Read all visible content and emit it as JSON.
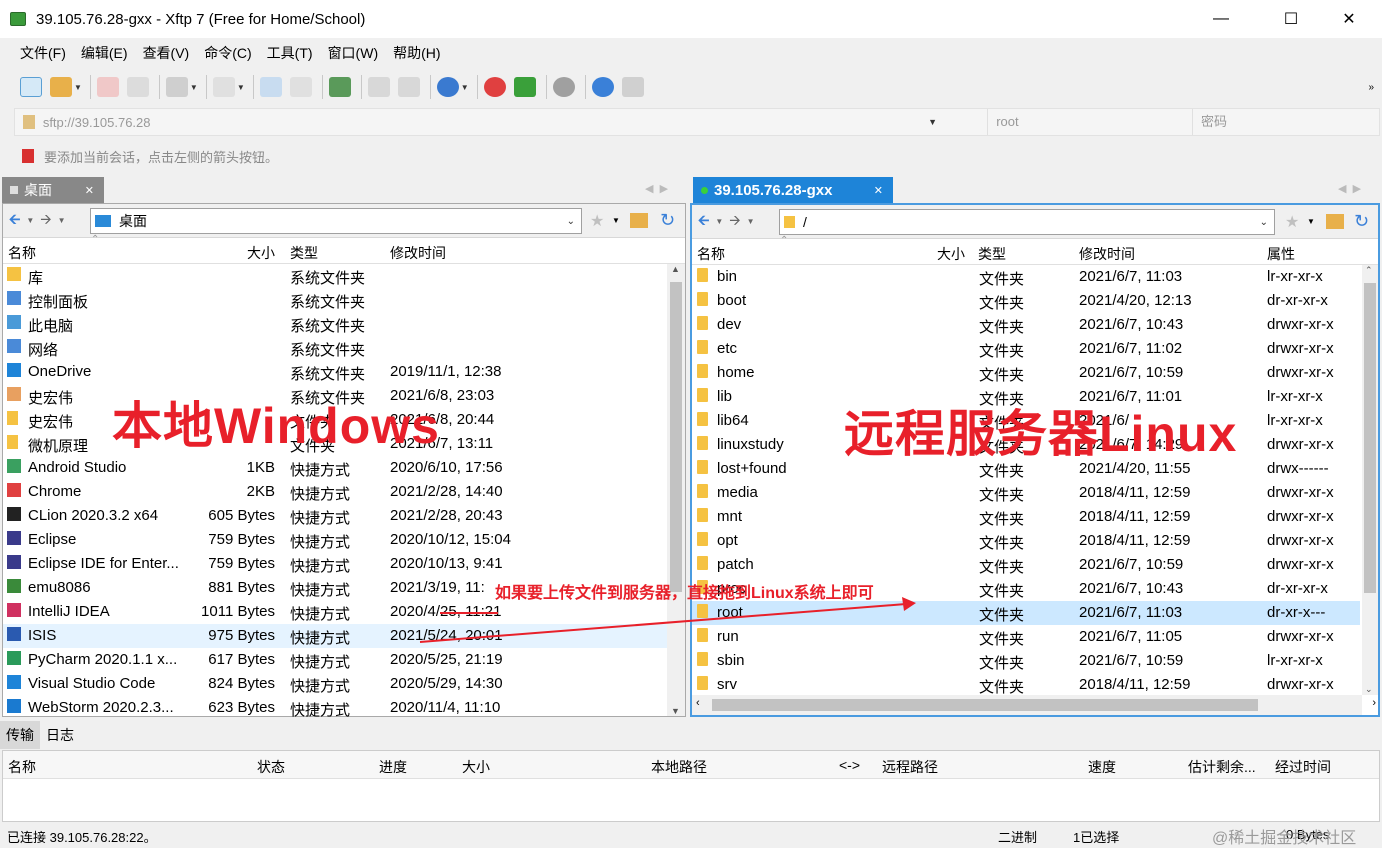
{
  "window": {
    "title": "39.105.76.28-gxx - Xftp 7 (Free for Home/School)"
  },
  "menu": [
    "文件(F)",
    "编辑(E)",
    "查看(V)",
    "命令(C)",
    "工具(T)",
    "窗口(W)",
    "帮助(H)"
  ],
  "address": {
    "host_placeholder": "sftp://39.105.76.28",
    "user_placeholder": "root",
    "password_placeholder": "密码"
  },
  "hint": "要添加当前会话，点击左侧的箭头按钮。",
  "left_pane": {
    "tab": "桌面",
    "path": "桌面",
    "columns": [
      "名称",
      "大小",
      "类型",
      "修改时间"
    ],
    "rows": [
      {
        "name": "库",
        "size": "",
        "type": "系统文件夹",
        "mtime": "",
        "icon": "library-icon"
      },
      {
        "name": "控制面板",
        "size": "",
        "type": "系统文件夹",
        "mtime": "",
        "icon": "control-panel-icon"
      },
      {
        "name": "此电脑",
        "size": "",
        "type": "系统文件夹",
        "mtime": "",
        "icon": "computer-icon"
      },
      {
        "name": "网络",
        "size": "",
        "type": "系统文件夹",
        "mtime": "",
        "icon": "network-icon"
      },
      {
        "name": "OneDrive",
        "size": "",
        "type": "系统文件夹",
        "mtime": "2019/11/1, 12:38",
        "icon": "onedrive-icon"
      },
      {
        "name": "史宏伟",
        "size": "",
        "type": "系统文件夹",
        "mtime": "2021/6/8, 23:03",
        "icon": "user-icon"
      },
      {
        "name": "史宏伟",
        "size": "",
        "type": "文件夹",
        "mtime": "2021/6/8, 20:44",
        "icon": "folder-icon"
      },
      {
        "name": "微机原理",
        "size": "",
        "type": "文件夹",
        "mtime": "2021/6/7, 13:11",
        "icon": "folder-icon"
      },
      {
        "name": "Android Studio",
        "size": "1KB",
        "type": "快捷方式",
        "mtime": "2020/6/10, 17:56",
        "icon": "android-studio-icon"
      },
      {
        "name": "Chrome",
        "size": "2KB",
        "type": "快捷方式",
        "mtime": "2021/2/28, 14:40",
        "icon": "chrome-icon"
      },
      {
        "name": "CLion 2020.3.2 x64",
        "size": "605 Bytes",
        "type": "快捷方式",
        "mtime": "2021/2/28, 20:43",
        "icon": "clion-icon"
      },
      {
        "name": "Eclipse",
        "size": "759 Bytes",
        "type": "快捷方式",
        "mtime": "2020/10/12, 15:04",
        "icon": "eclipse-icon"
      },
      {
        "name": "Eclipse IDE for Enter...",
        "size": "759 Bytes",
        "type": "快捷方式",
        "mtime": "2020/10/13, 9:41",
        "icon": "eclipse-icon"
      },
      {
        "name": "emu8086",
        "size": "881 Bytes",
        "type": "快捷方式",
        "mtime": "2021/3/19, 11:",
        "icon": "emu8086-icon"
      },
      {
        "name": "IntelliJ IDEA",
        "size": "1011 Bytes",
        "type": "快捷方式",
        "mtime": "2020/4/25, 11:21",
        "icon": "intellij-icon"
      },
      {
        "name": "ISIS",
        "size": "975 Bytes",
        "type": "快捷方式",
        "mtime": "2021/5/24, 20:01",
        "icon": "isis-icon"
      },
      {
        "name": "PyCharm 2020.1.1 x...",
        "size": "617 Bytes",
        "type": "快捷方式",
        "mtime": "2020/5/25, 21:19",
        "icon": "pycharm-icon"
      },
      {
        "name": "Visual Studio Code",
        "size": "824 Bytes",
        "type": "快捷方式",
        "mtime": "2020/5/29, 14:30",
        "icon": "vscode-icon"
      },
      {
        "name": "WebStorm 2020.2.3...",
        "size": "623 Bytes",
        "type": "快捷方式",
        "mtime": "2020/11/4, 11:10",
        "icon": "webstorm-icon"
      }
    ]
  },
  "right_pane": {
    "tab": "39.105.76.28-gxx",
    "path": "/",
    "columns": [
      "名称",
      "大小",
      "类型",
      "修改时间",
      "属性"
    ],
    "rows": [
      {
        "name": "bin",
        "type": "文件夹",
        "mtime": "2021/6/7, 11:03",
        "attr": "lr-xr-xr-x"
      },
      {
        "name": "boot",
        "type": "文件夹",
        "mtime": "2021/4/20, 12:13",
        "attr": "dr-xr-xr-x"
      },
      {
        "name": "dev",
        "type": "文件夹",
        "mtime": "2021/6/7, 10:43",
        "attr": "drwxr-xr-x"
      },
      {
        "name": "etc",
        "type": "文件夹",
        "mtime": "2021/6/7, 11:02",
        "attr": "drwxr-xr-x"
      },
      {
        "name": "home",
        "type": "文件夹",
        "mtime": "2021/6/7, 10:59",
        "attr": "drwxr-xr-x"
      },
      {
        "name": "lib",
        "type": "文件夹",
        "mtime": "2021/6/7, 11:01",
        "attr": "lr-xr-xr-x"
      },
      {
        "name": "lib64",
        "type": "文件夹",
        "mtime": "2021/6/",
        "attr": "lr-xr-xr-x"
      },
      {
        "name": "linuxstudy",
        "type": "文件夹",
        "mtime": "2021/6/7, 14:29",
        "attr": "drwxr-xr-x"
      },
      {
        "name": "lost+found",
        "type": "文件夹",
        "mtime": "2021/4/20, 11:55",
        "attr": "drwx------"
      },
      {
        "name": "media",
        "type": "文件夹",
        "mtime": "2018/4/11, 12:59",
        "attr": "drwxr-xr-x"
      },
      {
        "name": "mnt",
        "type": "文件夹",
        "mtime": "2018/4/11, 12:59",
        "attr": "drwxr-xr-x"
      },
      {
        "name": "opt",
        "type": "文件夹",
        "mtime": "2018/4/11, 12:59",
        "attr": "drwxr-xr-x"
      },
      {
        "name": "patch",
        "type": "文件夹",
        "mtime": "2021/6/7, 10:59",
        "attr": "drwxr-xr-x"
      },
      {
        "name": "proc",
        "type": "文件夹",
        "mtime": "2021/6/7, 10:43",
        "attr": "dr-xr-xr-x"
      },
      {
        "name": "root",
        "type": "文件夹",
        "mtime": "2021/6/7, 11:03",
        "attr": "dr-xr-x---"
      },
      {
        "name": "run",
        "type": "文件夹",
        "mtime": "2021/6/7, 11:05",
        "attr": "drwxr-xr-x"
      },
      {
        "name": "sbin",
        "type": "文件夹",
        "mtime": "2021/6/7, 10:59",
        "attr": "lr-xr-xr-x"
      },
      {
        "name": "srv",
        "type": "文件夹",
        "mtime": "2018/4/11, 12:59",
        "attr": "drwxr-xr-x"
      }
    ]
  },
  "annotations": {
    "local_label": "本地Windows",
    "remote_label": "远程服务器Linux",
    "instruction": "如果要上传文件到服务器，直接拖到Linux系统上即可"
  },
  "bottom": {
    "tabs": [
      "传输",
      "日志"
    ],
    "columns": [
      "名称",
      "状态",
      "进度",
      "大小",
      "本地路径",
      "<->",
      "远程路径",
      "速度",
      "估计剩余...",
      "经过时间"
    ]
  },
  "status": {
    "connected": "已连接 39.105.76.28:22。",
    "mode": "二进制",
    "selection": "1已选择",
    "size": "0 Bytes",
    "watermark": "@稀土掘金技术社区"
  },
  "colors": {
    "accent": "#1e84d8",
    "annotation": "#e8202a",
    "selected_row": "#cce8ff"
  }
}
